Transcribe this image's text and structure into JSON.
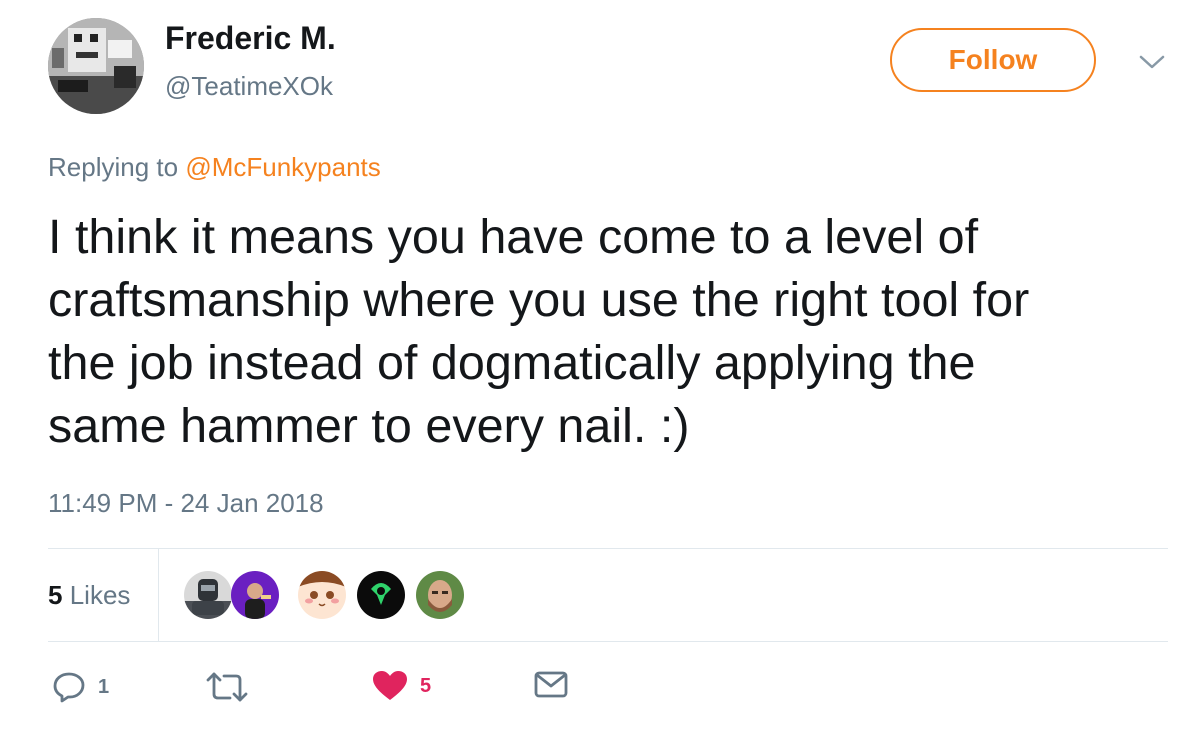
{
  "user": {
    "display_name": "Frederic M.",
    "handle": "@TeatimeXOk",
    "avatar_icon": "pixel-art-avatar"
  },
  "follow_button": {
    "label": "Follow",
    "color": "#f5821f"
  },
  "menu": {
    "icon": "chevron-down-icon"
  },
  "reply_context": {
    "prefix": "Replying to",
    "mention": "@McFunkypants"
  },
  "tweet": {
    "lines": [
      "I think it means you have come to a level of",
      "craftsmanship where you use the right tool for",
      "the job instead of dogmatically applying the",
      "same hammer to every nail. :)"
    ],
    "timestamp": "11:49 PM - 24 Jan 2018"
  },
  "likes": {
    "count": "5",
    "label": "Likes",
    "avatars": [
      "armored-soldier-avatar",
      "person-purple-avatar",
      "anime-face-avatar",
      "green-logo-avatar",
      "bearded-man-avatar"
    ]
  },
  "actions": {
    "reply": {
      "icon": "reply-icon",
      "count": "1"
    },
    "retweet": {
      "icon": "retweet-icon",
      "count": ""
    },
    "like": {
      "icon": "heart-icon",
      "count": "5",
      "color": "#e0245e"
    },
    "message": {
      "icon": "envelope-icon"
    }
  },
  "colors": {
    "accent": "#f5821f",
    "secondary_text": "#657786",
    "like": "#e0245e"
  }
}
